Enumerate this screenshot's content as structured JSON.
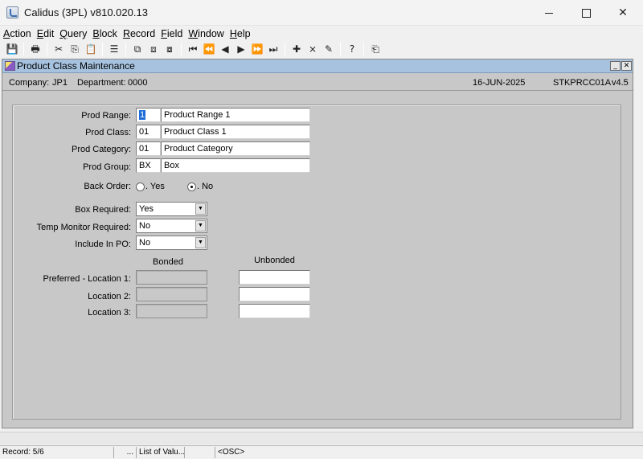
{
  "window": {
    "title": "Calidus (3PL) v810.020.13",
    "close_glyph": "✕"
  },
  "menu": [
    {
      "label": "Action",
      "key": "A",
      "rest": "ction"
    },
    {
      "label": "Edit",
      "key": "E",
      "rest": "dit"
    },
    {
      "label": "Query",
      "key": "Q",
      "rest": "uery"
    },
    {
      "label": "Block",
      "key": "B",
      "rest": "lock"
    },
    {
      "label": "Record",
      "key": "R",
      "rest": "ecord"
    },
    {
      "label": "Field",
      "key": "F",
      "rest": "ield"
    },
    {
      "label": "Window",
      "key": "W",
      "rest": "indow"
    },
    {
      "label": "Help",
      "key": "H",
      "rest": "elp"
    }
  ],
  "toolbar": {
    "save": "💾",
    "print": "🖶",
    "cut": "✂",
    "copy": "⎘",
    "paste": "📋",
    "list": "☰",
    "copy_record": "⧉",
    "paste_record": "⧈",
    "duplicate": "⧇",
    "first": "⏮",
    "prev_block": "⏪",
    "prev": "◀",
    "next": "▶",
    "next_block": "⏩",
    "last": "⏭",
    "insert": "✚",
    "delete": "⨯",
    "clear": "✎",
    "help": "?",
    "exit": "⎗"
  },
  "form": {
    "title": "Product Class Maintenance",
    "min_glyph": "_",
    "close_glyph": "✕",
    "company_label": "Company:",
    "company_value": "JP1",
    "department_label": "Department:",
    "department_value": "0000",
    "date": "16-JUN-2025",
    "screen_code": "STKPRCC01A",
    "version": "v4.5"
  },
  "fields": {
    "prod_range": {
      "label": "Prod Range:",
      "code": "1",
      "desc": "Product Range 1"
    },
    "prod_class": {
      "label": "Prod Class:",
      "code": "01",
      "desc": "Product Class 1"
    },
    "prod_category": {
      "label": "Prod Category:",
      "code": "01",
      "desc": "Product Category"
    },
    "prod_group": {
      "label": "Prod Group:",
      "code": "BX",
      "desc": "Box"
    },
    "back_order": {
      "label": "Back Order:",
      "yes": ". Yes",
      "no": ". No",
      "selected": "No"
    },
    "box_required": {
      "label": "Box Required:",
      "value": "Yes"
    },
    "temp_monitor": {
      "label": "Temp Monitor Required:",
      "value": "No"
    },
    "include_po": {
      "label": "Include In PO:",
      "value": "No"
    },
    "bonded_header": "Bonded",
    "unbonded_header": "Unbonded",
    "preferred_loc1": {
      "label": "Preferred - Location 1:"
    },
    "loc2": {
      "label": "Location 2:"
    },
    "loc3": {
      "label": "Location 3:"
    }
  },
  "status": {
    "record": "Record: 5/6",
    "dots": "...",
    "list_of_values": "List of Valu...",
    "osc": "<OSC>"
  }
}
